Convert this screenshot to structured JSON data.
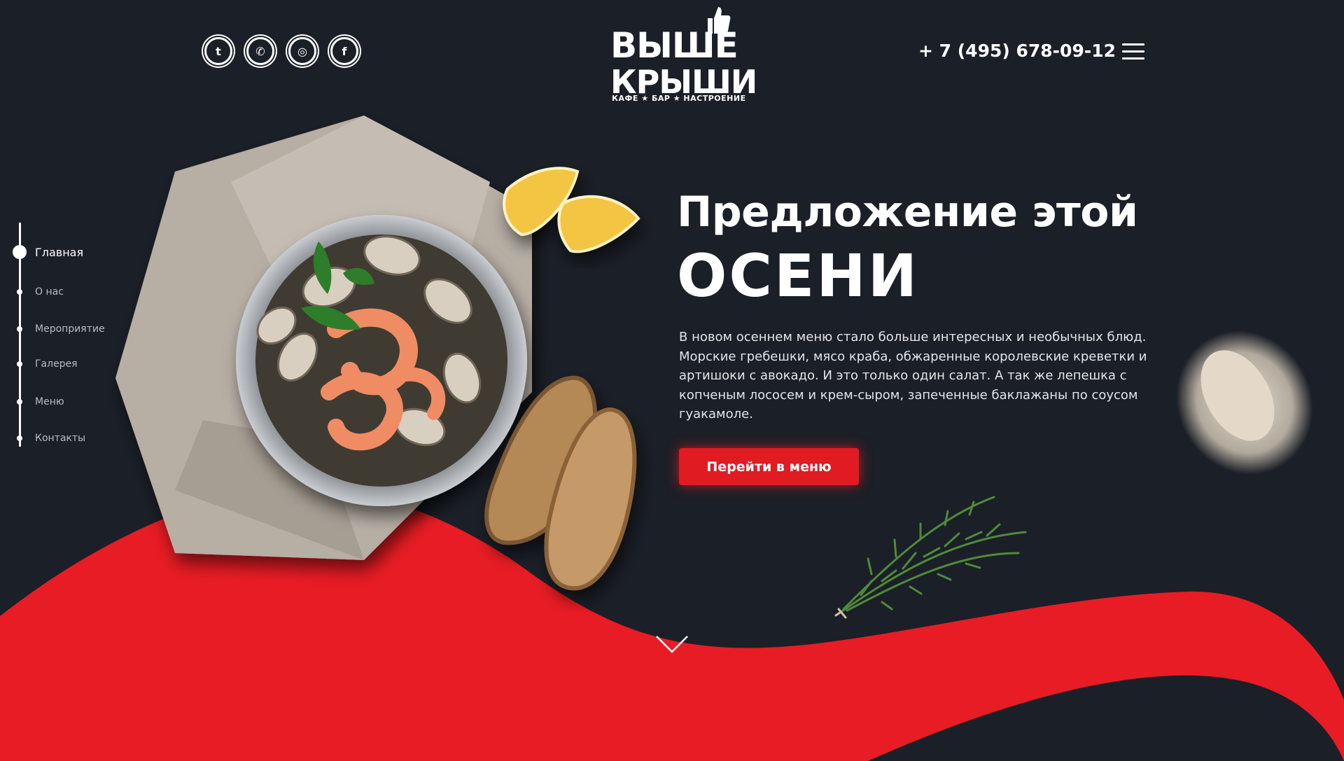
{
  "brand": {
    "line1": "ВЫШЕ",
    "line2": "КРЫШИ",
    "tagline": "КАФЕ ★ БАР ★ НАСТРОЕНИЕ"
  },
  "header": {
    "socials": [
      {
        "name": "twitter-icon",
        "glyph": "t"
      },
      {
        "name": "whatsapp-icon",
        "glyph": "✆"
      },
      {
        "name": "instagram-icon",
        "glyph": "◎"
      },
      {
        "name": "facebook-icon",
        "glyph": "f"
      }
    ],
    "phone": "+ 7 (495) 678-09-12"
  },
  "sidenav": {
    "items": [
      {
        "label": "Главная",
        "active": true
      },
      {
        "label": "О нас",
        "active": false
      },
      {
        "label": "Мероприятие",
        "active": false
      },
      {
        "label": "Галерея",
        "active": false
      },
      {
        "label": "Меню",
        "active": false
      },
      {
        "label": "Контакты",
        "active": false
      }
    ]
  },
  "hero": {
    "title_line1": "Предложение этой",
    "title_line2": "ОСЕНИ",
    "description": "В новом осеннем меню стало больше интересных и необычных блюд. Морские гребешки, мясо краба, обжаренные королевские креветки и артишоки с авокадо. И это только один салат. А так же лепешка с  копченым лососем и крем-сыром,  запеченные баклажаны по соусом гуакамоле.",
    "cta_label": "Перейти в меню"
  },
  "colors": {
    "background": "#1b1f27",
    "accent": "#e11b22",
    "text": "#ffffff"
  }
}
